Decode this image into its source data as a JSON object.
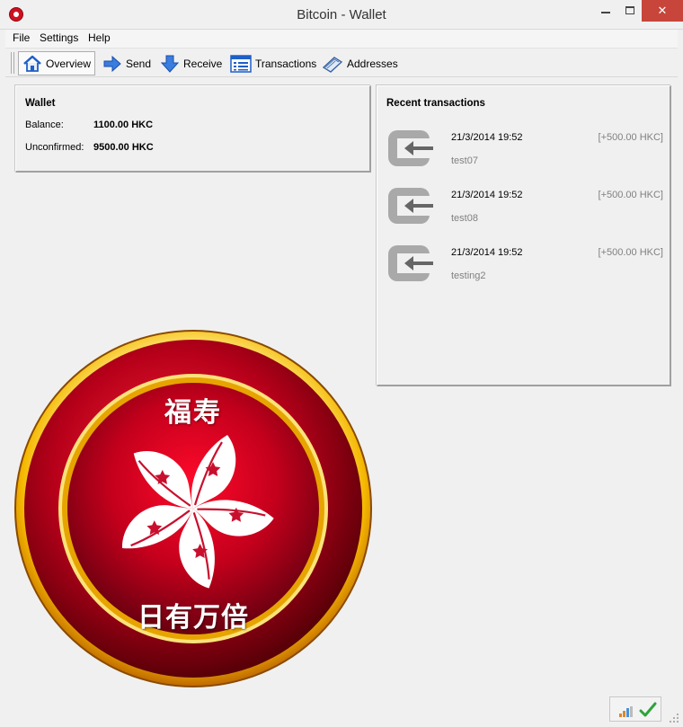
{
  "window": {
    "title": "Bitcoin - Wallet",
    "minimize_icon": "minimize-icon",
    "maximize_icon": "maximize-icon",
    "close_glyph": "✕"
  },
  "menu": [
    "File",
    "Settings",
    "Help"
  ],
  "toolbar": {
    "overview": "Overview",
    "send": "Send",
    "receive": "Receive",
    "transactions": "Transactions",
    "addresses": "Addresses"
  },
  "wallet": {
    "title": "Wallet",
    "balance_label": "Balance:",
    "balance_value": "1100.00 HKC",
    "unconfirmed_label": "Unconfirmed:",
    "unconfirmed_value": "9500.00 HKC"
  },
  "recent": {
    "title": "Recent transactions",
    "items": [
      {
        "date": "21/3/2014 19:52",
        "amount": "[+500.00 HKC]",
        "label": "test07"
      },
      {
        "date": "21/3/2014 19:52",
        "amount": "[+500.00 HKC]",
        "label": "test08"
      },
      {
        "date": "21/3/2014 19:52",
        "amount": "[+500.00 HKC]",
        "label": "testing2"
      }
    ]
  },
  "coin": {
    "top_text": "福寿",
    "bottom_text": "日有万倍"
  },
  "colors": {
    "coin_red": "#c8102e",
    "coin_gold": "#f2c12e",
    "accent_blue": "#1e5fc8"
  }
}
